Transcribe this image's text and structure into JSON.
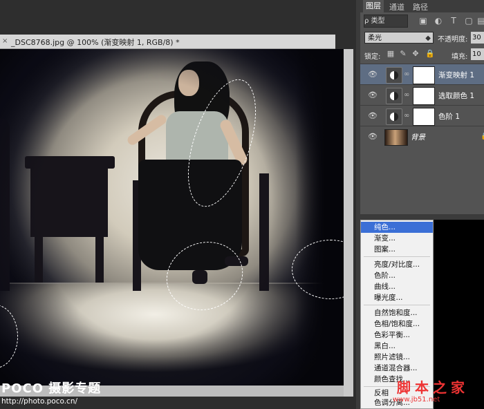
{
  "document": {
    "title": "_DSC8768.jpg @ 100% (渐变映射 1, RGB/8) *",
    "close_glyph": "×"
  },
  "watermark_left": {
    "logo": "POCO 摄影专题",
    "url": "http://photo.poco.cn/"
  },
  "layers_panel": {
    "tabs": [
      "图层",
      "通道",
      "路径"
    ],
    "filter_label": "ρ 类型",
    "blend_mode": "柔光",
    "opacity_label": "不透明度:",
    "opacity_value": "30",
    "lock_label": "锁定:",
    "fill_label": "填充:",
    "fill_value": "10",
    "layers": [
      {
        "name": "渐变映射 1",
        "selected": true
      },
      {
        "name": "选取颜色 1",
        "selected": false
      },
      {
        "name": "色阶 1",
        "selected": false
      },
      {
        "name": "背景",
        "selected": false
      }
    ]
  },
  "adjustment_menu": {
    "items": [
      "纯色...",
      "渐变...",
      "图案...",
      "亮度/对比度...",
      "色阶...",
      "曲线...",
      "曝光度...",
      "自然饱和度...",
      "色相/饱和度...",
      "色彩平衡...",
      "黑白...",
      "照片滤镜...",
      "通道混合器...",
      "颜色查找...",
      "反相",
      "色调分离..."
    ],
    "highlighted": "纯色..."
  },
  "watermark_right": {
    "text_cn": "脚本之家",
    "text_en": "www.jb51.net"
  },
  "colors": {
    "selection": "#3b6fd6",
    "selected_layer": "#5e6d83",
    "watermark_red": "#ee3333"
  }
}
